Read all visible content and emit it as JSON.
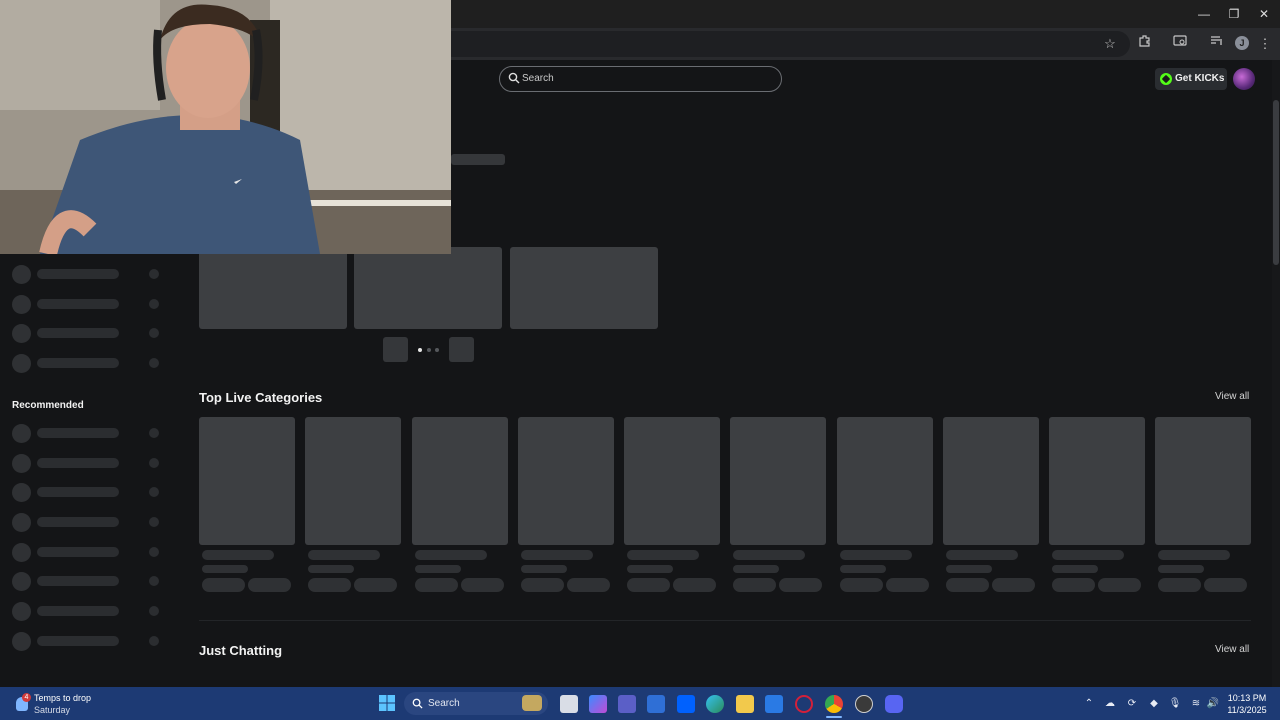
{
  "browser": {
    "window_controls": {
      "minimize": "—",
      "restore": "❐",
      "close": "✕"
    },
    "toolbar_icons": [
      "star-icon",
      "extensions-icon",
      "cast-icon",
      "media-icon",
      "profile-icon",
      "menu-icon"
    ],
    "profile_initial": "J"
  },
  "site": {
    "search": {
      "placeholder": "Search"
    },
    "get_kicks_label": "Get KICKs",
    "accent_color": "#53fc18"
  },
  "sidebar": {
    "recommended_heading": "Recommended"
  },
  "main": {
    "top_live_categories": {
      "title": "Top Live Categories",
      "view_all": "View all"
    },
    "just_chatting": {
      "title": "Just Chatting",
      "view_all": "View all"
    },
    "carousel": {
      "page_count": 3,
      "active_page": 1
    }
  },
  "taskbar": {
    "weather": {
      "line1": "Temps to drop",
      "line2": "Saturday",
      "badge": "4"
    },
    "search_placeholder": "Search",
    "clock": {
      "time": "10:13 PM",
      "date": "11/3/2025"
    }
  }
}
